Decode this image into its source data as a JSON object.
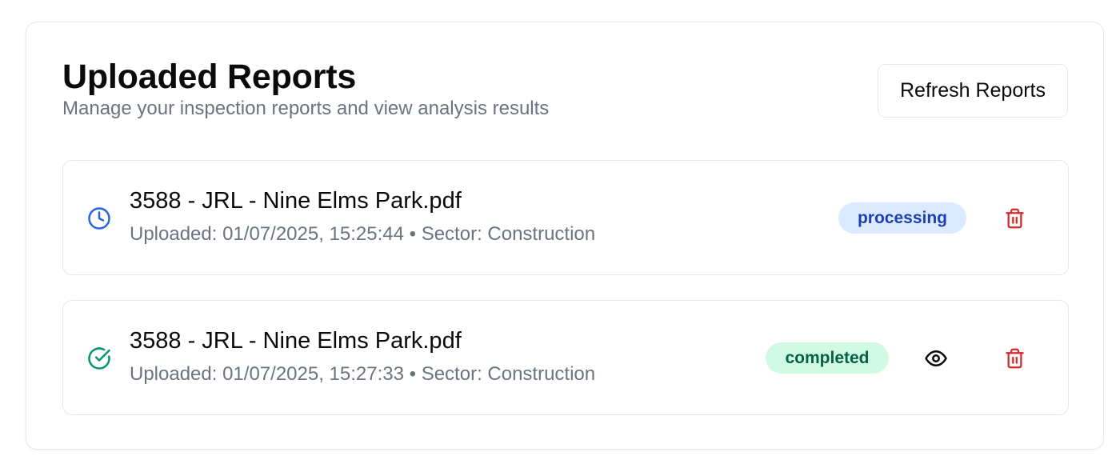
{
  "header": {
    "title": "Uploaded Reports",
    "subtitle": "Manage your inspection reports and view analysis results",
    "refresh_label": "Refresh Reports"
  },
  "reports": [
    {
      "file_name": "3588 - JRL - Nine Elms Park.pdf",
      "meta": "Uploaded: 01/07/2025, 15:25:44 • Sector: Construction",
      "status": "processing",
      "status_icon": "clock-icon",
      "status_color": "#2563eb",
      "actions": [
        "delete"
      ]
    },
    {
      "file_name": "3588 - JRL - Nine Elms Park.pdf",
      "meta": "Uploaded: 01/07/2025, 15:27:33 • Sector: Construction",
      "status": "completed",
      "status_icon": "check-circle-icon",
      "status_color": "#059669",
      "actions": [
        "view",
        "delete"
      ]
    }
  ],
  "colors": {
    "delete": "#dc2626",
    "processing_badge_bg": "#dbeafe",
    "processing_badge_text": "#1e40af",
    "completed_badge_bg": "#d1fae5",
    "completed_badge_text": "#065f46"
  }
}
